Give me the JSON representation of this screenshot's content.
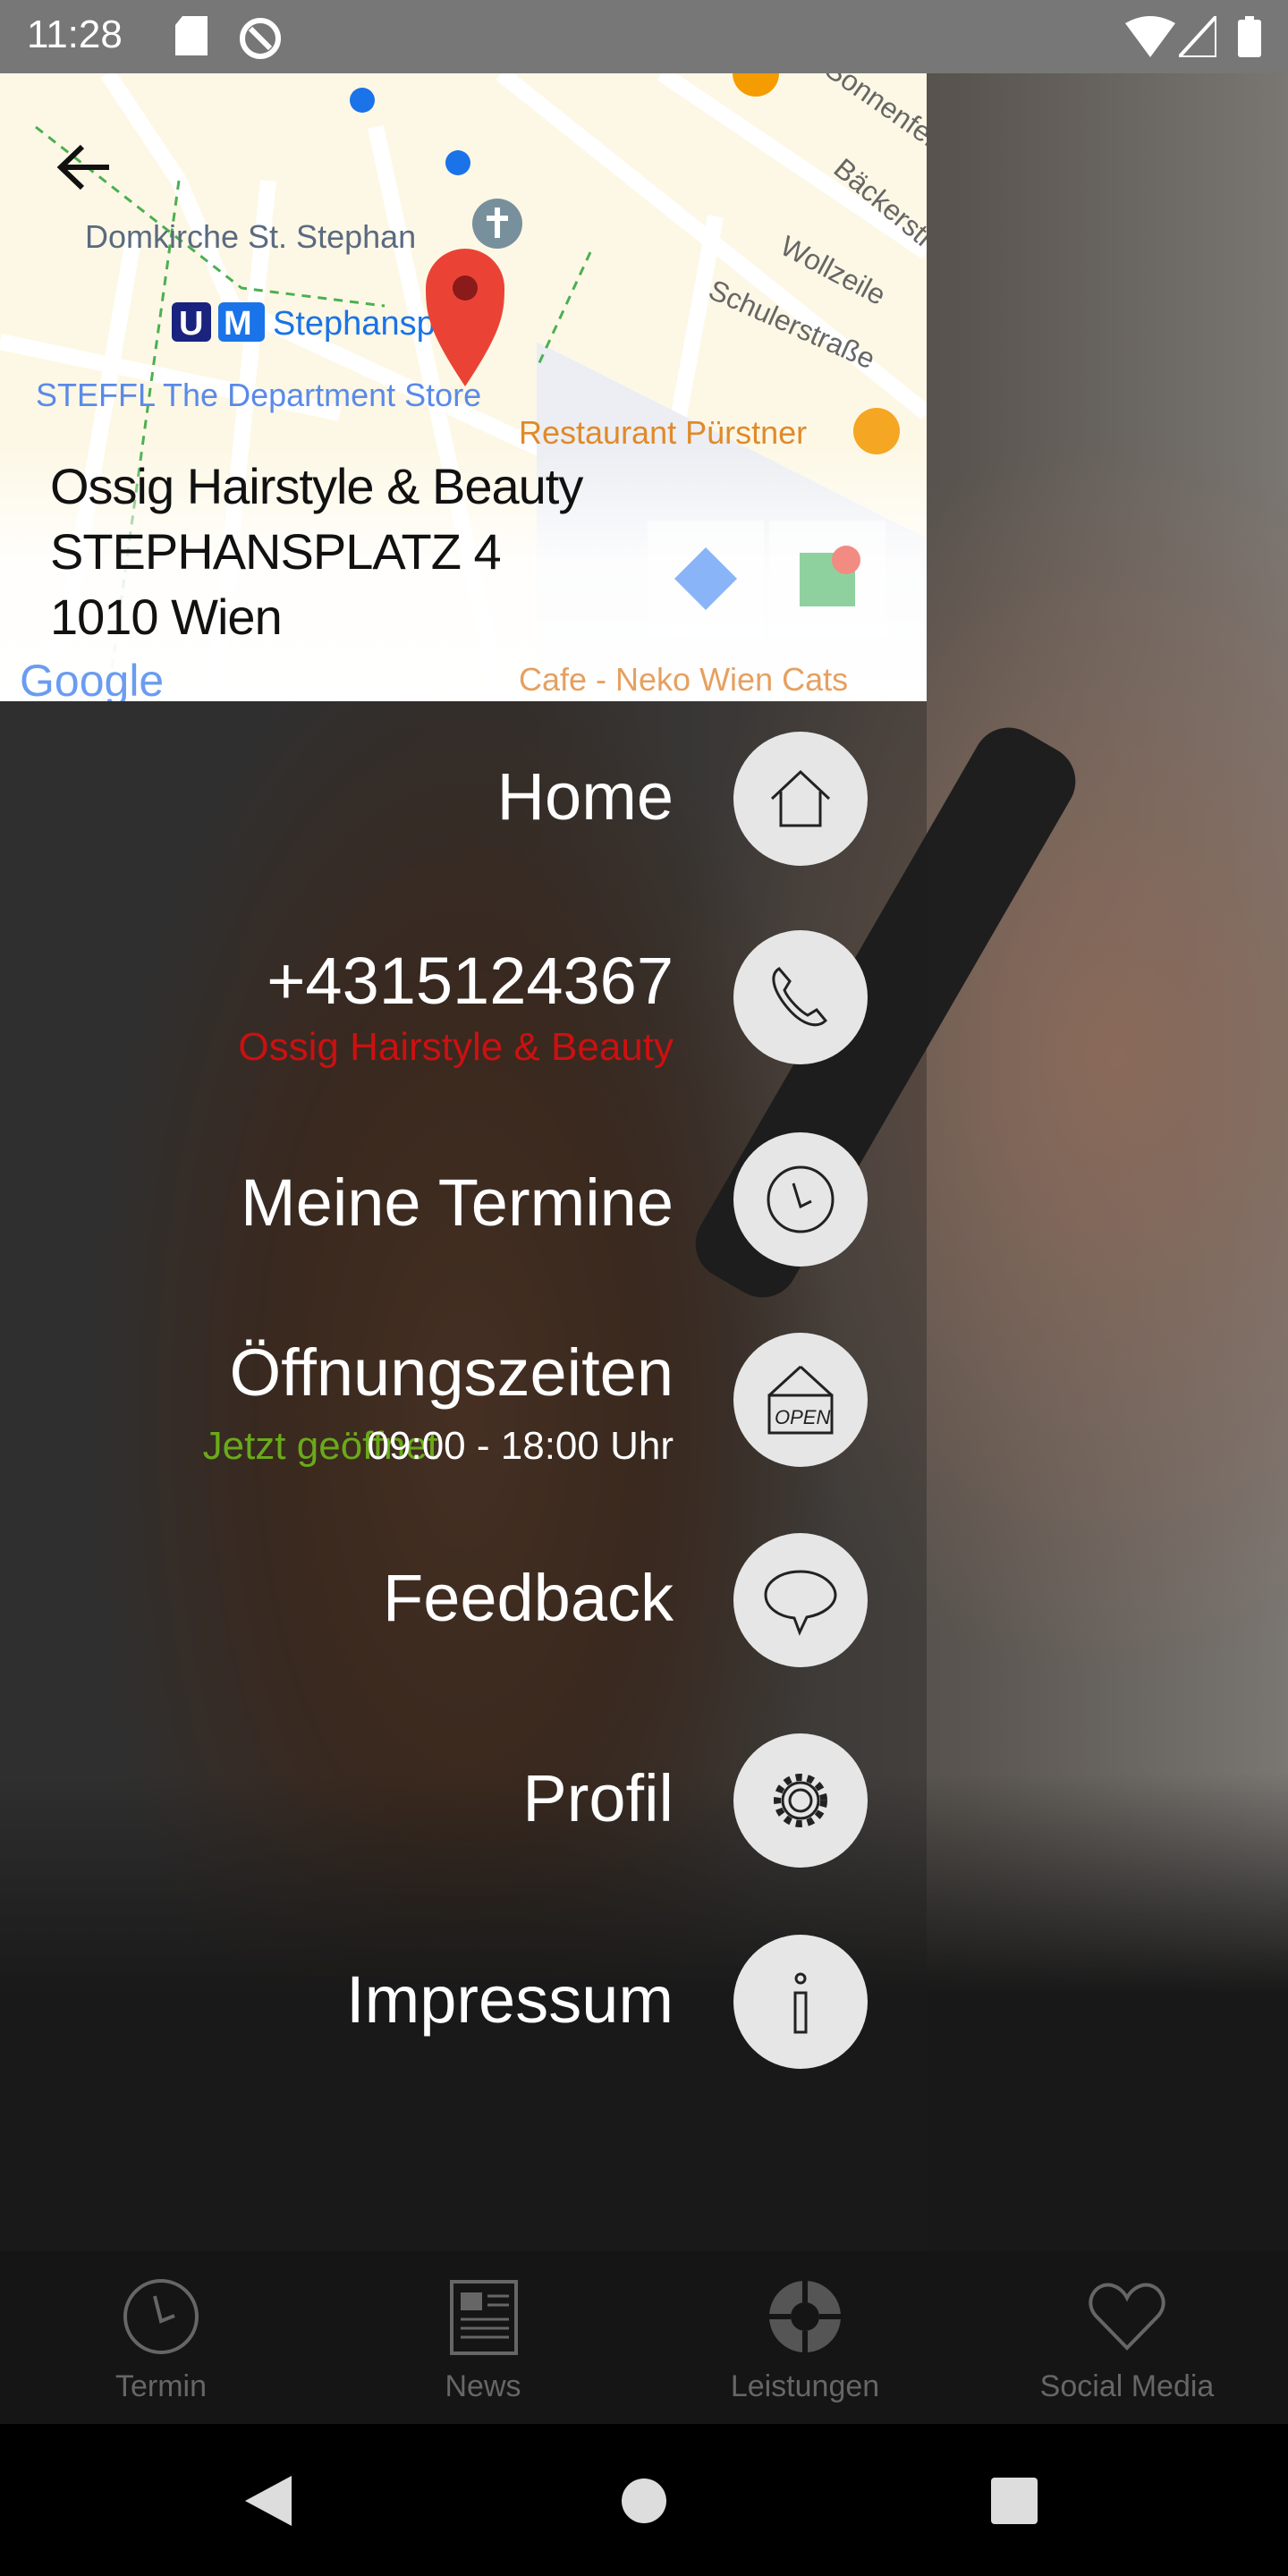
{
  "status_bar": {
    "time": "11:28"
  },
  "map": {
    "labels": [
      "Domkirche St. Stephan",
      "Stephansplatz",
      "Wollzeile",
      "Schulerstraße",
      "Bäckerstraße",
      "Sonnenfelsgasse",
      "Restaurant Pürstner",
      "STEFFL The Department Store",
      "Cafe - Neko Wien Cats",
      "Google"
    ],
    "address": {
      "name": "Ossig Hairstyle & Beauty",
      "street": "STEPHANSPLATZ 4",
      "city": "1010 Wien"
    }
  },
  "menu": {
    "home": {
      "label": "Home",
      "icon": "home-icon"
    },
    "phone": {
      "label": "+4315124367",
      "sub": "Ossig Hairstyle & Beauty",
      "icon": "phone-icon",
      "sub_color": "#cc1010"
    },
    "termine": {
      "label": "Meine Termine",
      "icon": "clock-icon"
    },
    "hours": {
      "label": "Öffnungszeiten",
      "status": "Jetzt geöffnet",
      "time": "09:00 - 18:00 Uhr",
      "icon": "open-sign-icon",
      "status_color": "#6aaa1a"
    },
    "feedback": {
      "label": "Feedback",
      "icon": "speech-bubble-icon"
    },
    "profil": {
      "label": "Profil",
      "icon": "gear-icon"
    },
    "impressum": {
      "label": "Impressum",
      "icon": "info-icon"
    }
  },
  "bottom_nav": [
    {
      "label": "Termin"
    },
    {
      "label": "News"
    },
    {
      "label": "Leistungen"
    },
    {
      "label": "Social Media"
    }
  ]
}
